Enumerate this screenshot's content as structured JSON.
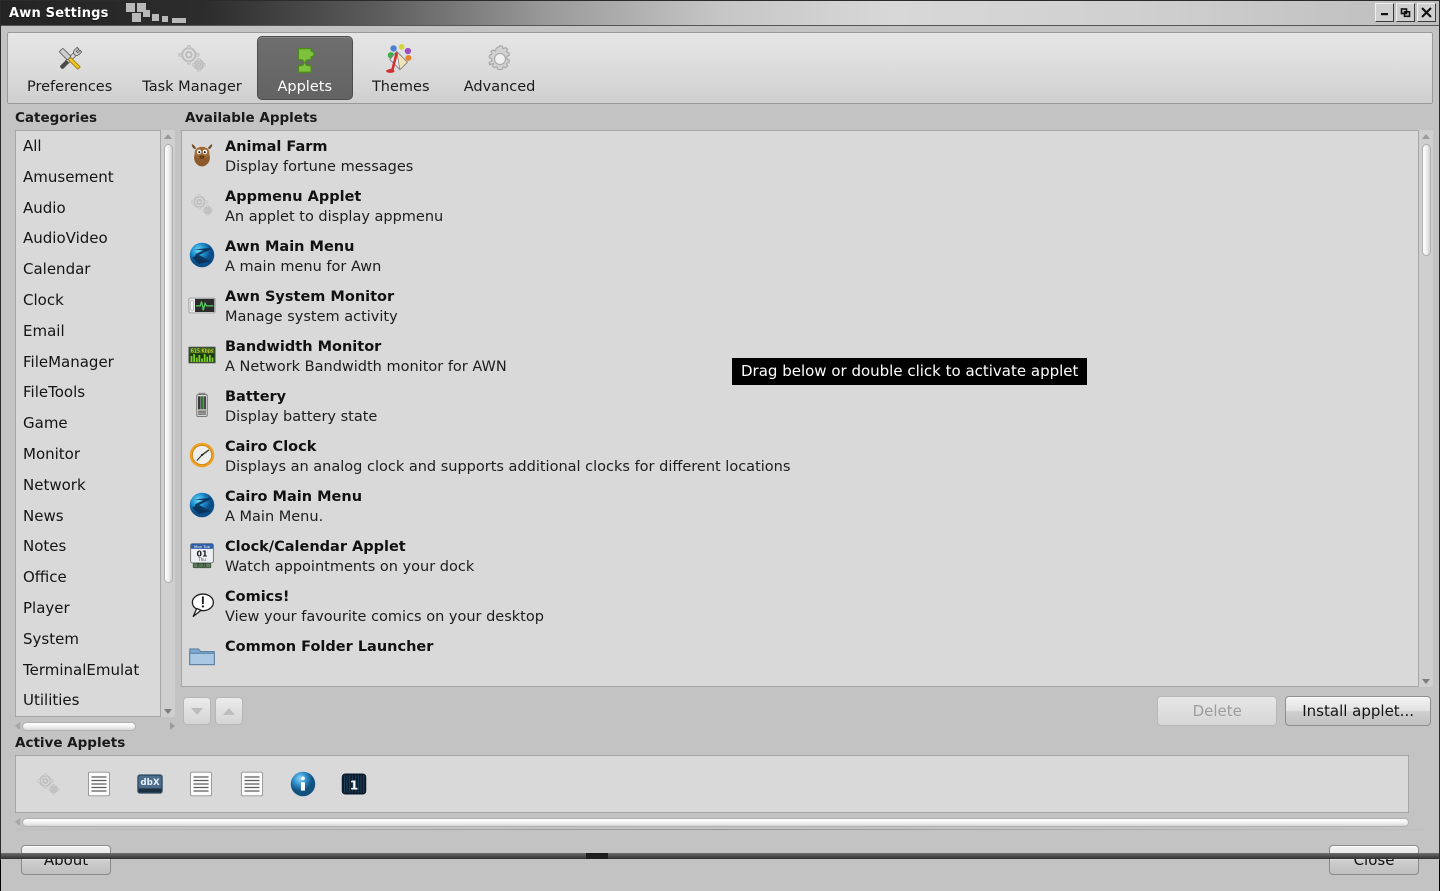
{
  "window": {
    "title": "Awn Settings",
    "controls": [
      {
        "name": "minimize",
        "glyph": "minimize-icon"
      },
      {
        "name": "maximize",
        "glyph": "maximize-icon"
      },
      {
        "name": "close",
        "glyph": "close-icon"
      }
    ]
  },
  "toolbar": {
    "tabs": [
      {
        "label": "Preferences",
        "icon": "tools-icon",
        "active": false
      },
      {
        "label": "Task Manager",
        "icon": "gears-icon",
        "active": false
      },
      {
        "label": "Applets",
        "icon": "puzzle-piece-icon",
        "active": true
      },
      {
        "label": "Themes",
        "icon": "paint-bucket-icon",
        "active": false
      },
      {
        "label": "Advanced",
        "icon": "gear-icon",
        "active": false
      }
    ]
  },
  "categories": {
    "title": "Categories",
    "items": [
      "All",
      "Amusement",
      "Audio",
      "AudioVideo",
      "Calendar",
      "Clock",
      "Email",
      "FileManager",
      "FileTools",
      "Game",
      "Monitor",
      "Network",
      "News",
      "Notes",
      "Office",
      "Player",
      "System",
      "TerminalEmulat",
      "Utilities"
    ]
  },
  "available_applets": {
    "title": "Available Applets",
    "items": [
      {
        "name": "Animal Farm",
        "desc": "Display fortune messages",
        "icon": "animal-farm-icon"
      },
      {
        "name": "Appmenu Applet",
        "desc": "An applet to display appmenu",
        "icon": "gears-icon"
      },
      {
        "name": "Awn Main Menu",
        "desc": "A main menu for Awn",
        "icon": "awn-logo-icon"
      },
      {
        "name": "Awn System Monitor",
        "desc": "Manage system activity",
        "icon": "system-monitor-icon"
      },
      {
        "name": "Bandwidth Monitor",
        "desc": "A Network Bandwidth monitor for AWN",
        "icon": "bandwidth-icon"
      },
      {
        "name": "Battery",
        "desc": "Display battery state",
        "icon": "battery-icon"
      },
      {
        "name": "Cairo Clock",
        "desc": "Displays an analog clock and supports additional clocks for different locations",
        "icon": "analog-clock-icon"
      },
      {
        "name": "Cairo Main Menu",
        "desc": "A Main Menu.",
        "icon": "awn-logo-icon"
      },
      {
        "name": "Clock/Calendar Applet",
        "desc": "Watch appointments on your dock",
        "icon": "calendar-icon"
      },
      {
        "name": "Comics!",
        "desc": "View your favourite comics on your desktop",
        "icon": "speech-bubble-icon"
      },
      {
        "name": "Common Folder Launcher",
        "desc": "",
        "icon": "folder-icon"
      }
    ]
  },
  "tooltip": {
    "text": "Drag below or double click to activate applet"
  },
  "action_bar": {
    "move_down_label": "move-down",
    "move_up_label": "move-up",
    "delete_label": "Delete",
    "delete_disabled": true,
    "install_label": "Install applet..."
  },
  "active_applets": {
    "title": "Active Applets",
    "items": [
      {
        "icon": "gears-icon",
        "label": "appmenu"
      },
      {
        "icon": "document-lines-icon",
        "label": "document"
      },
      {
        "icon": "dbx-icon",
        "label": "dbx"
      },
      {
        "icon": "document-lines-icon",
        "label": "document"
      },
      {
        "icon": "document-lines-icon",
        "label": "document"
      },
      {
        "icon": "info-icon",
        "label": "info"
      },
      {
        "icon": "pager-one-icon",
        "label": "1"
      }
    ]
  },
  "bottom_bar": {
    "about_label": "About",
    "close_label": "Close"
  },
  "colors": {
    "window_bg": "#c3c3c3",
    "list_bg": "#d9d9d9",
    "active_tab": "#686868",
    "tooltip_bg": "#000000",
    "accent_blue": "#2f83c5"
  }
}
